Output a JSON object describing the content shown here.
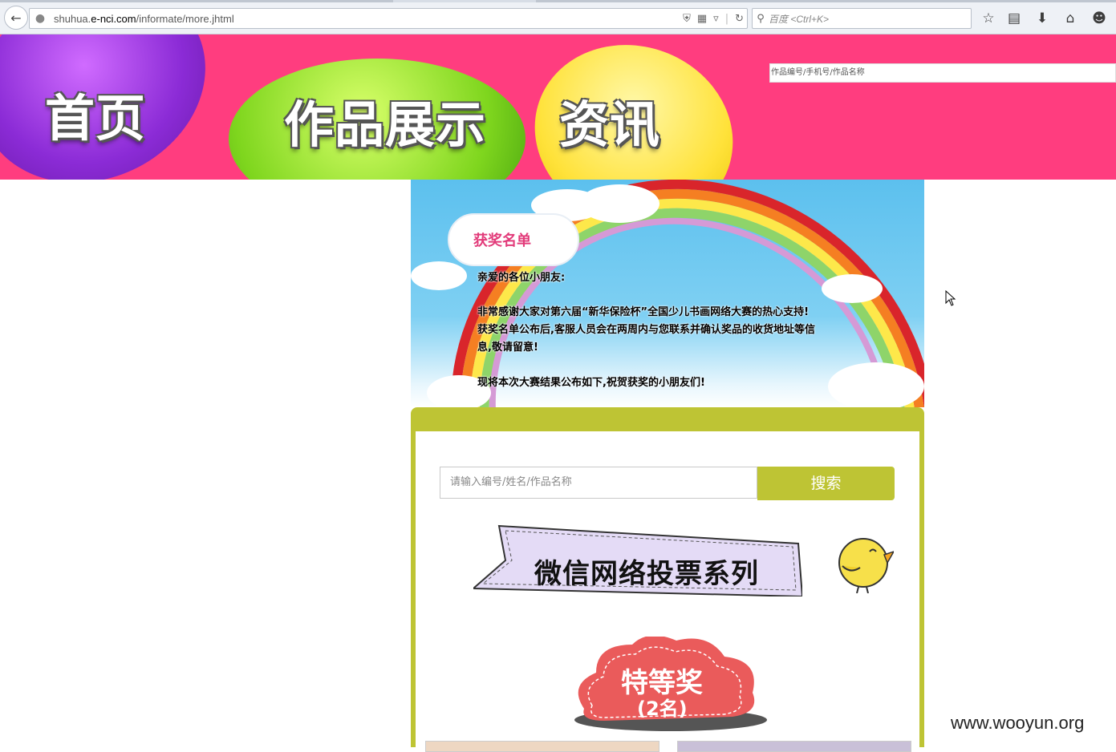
{
  "browser": {
    "url_prefix": "shuhua.",
    "url_domain": "e-nci.com",
    "url_path": "/informate/more.jhtml",
    "search_placeholder": "百度 <Ctrl+K>"
  },
  "header": {
    "nav": [
      "首页",
      "作品展示",
      "资讯"
    ],
    "search_placeholder": "作品编号/手机号/作品名称",
    "colors": {
      "banner": "#ff3d7f",
      "purple": "#8b2bd6",
      "green": "#7fd61e",
      "yellow": "#ffe23a"
    }
  },
  "notice": {
    "title": "获奖名单",
    "greeting": "亲爱的各位小朋友:",
    "line1": "非常感谢大家对第六届“新华保险杯”全国少儿书画网络大赛的热心支持!",
    "line2": "获奖名单公布后,客服人员会在两周内与您联系并确认奖品的收货地址等信",
    "line3": "息,敬请留意!",
    "line4": "现将本次大赛结果公布如下,祝贺获奖的小朋友们!"
  },
  "results": {
    "search_placeholder": "请输入编号/姓名/作品名称",
    "search_button": "搜索",
    "series_banner": "微信网络投票系列",
    "award_title": "特等奖",
    "award_count": "(2名)",
    "accent_color": "#bec434"
  },
  "watermark": "www.wooyun.org"
}
